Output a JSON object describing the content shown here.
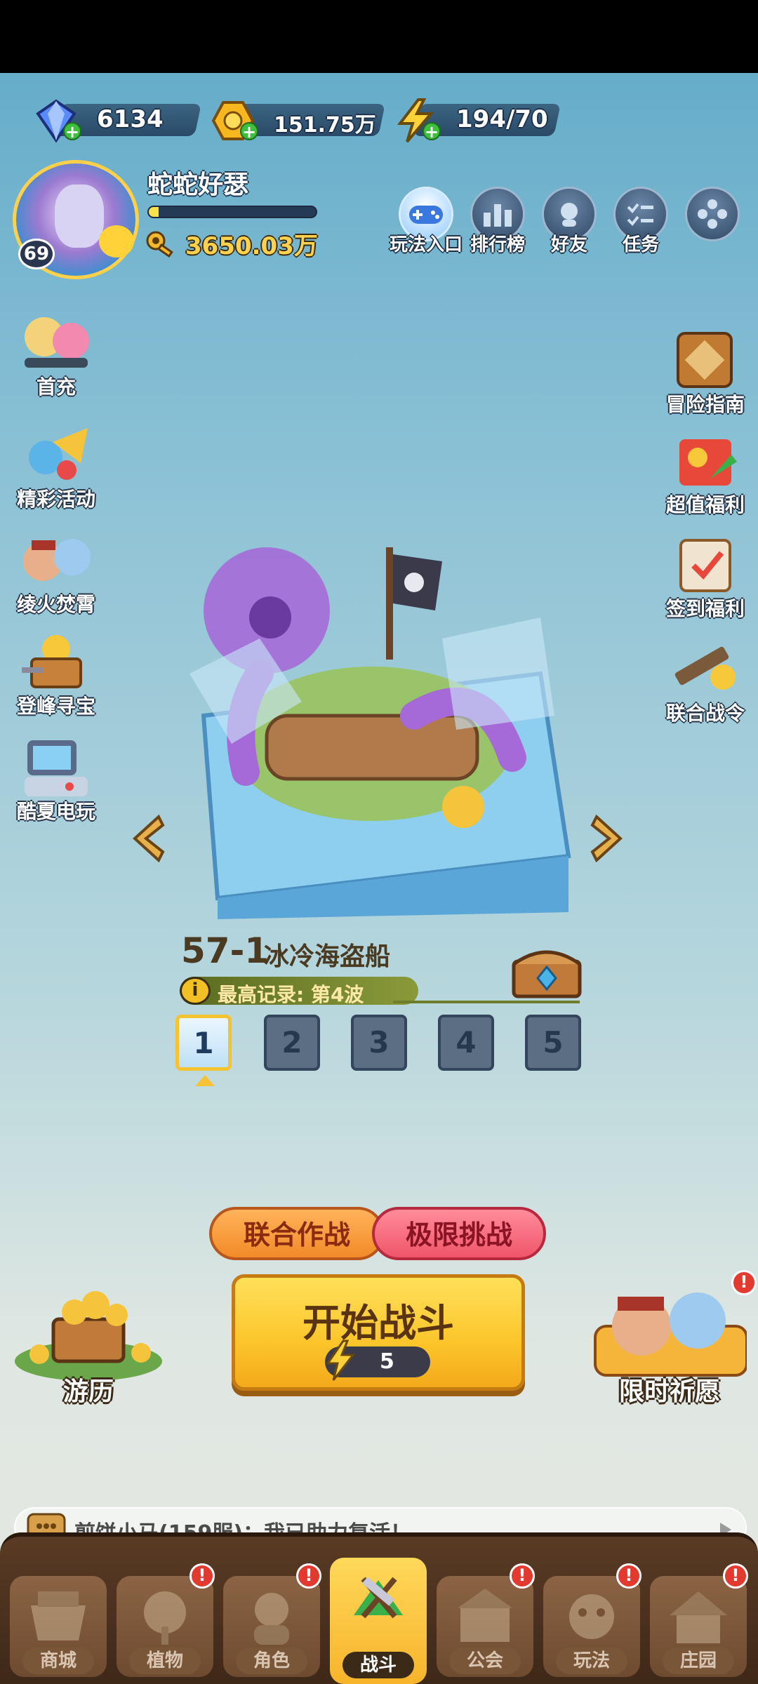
{
  "resources": {
    "gems": "6134",
    "gold": "151.75万",
    "energy": "194/70"
  },
  "profile": {
    "level": "69",
    "name": "蛇蛇好瑟",
    "xp_fraction": 0.06,
    "combat_power": "3650.03万"
  },
  "top_icons": [
    {
      "label": "玩法入口",
      "icon": "gamepad-icon"
    },
    {
      "label": "排行榜",
      "icon": "ranking-icon"
    },
    {
      "label": "好友",
      "icon": "friends-icon"
    },
    {
      "label": "任务",
      "icon": "task-icon"
    },
    {
      "label": "",
      "icon": "more-icon"
    }
  ],
  "left_menu": [
    {
      "label": "首充",
      "icon": "first-recharge-icon"
    },
    {
      "label": "精彩活动",
      "icon": "events-icon"
    },
    {
      "label": "绫火焚霄",
      "icon": "character-event-icon"
    },
    {
      "label": "登峰寻宝",
      "icon": "treasure-hunt-icon"
    },
    {
      "label": "酷夏电玩",
      "icon": "arcade-icon"
    }
  ],
  "right_menu": [
    {
      "label": "冒险指南",
      "icon": "adventure-guide-icon"
    },
    {
      "label": "超值福利",
      "icon": "value-welfare-icon"
    },
    {
      "label": "签到福利",
      "icon": "checkin-icon"
    },
    {
      "label": "联合战令",
      "icon": "battle-pass-icon"
    }
  ],
  "stage": {
    "number": "57-1",
    "name": "冰冷海盗船",
    "record_info_icon": "i",
    "record": "最高记录: 第4波",
    "waves": [
      "1",
      "2",
      "3",
      "4",
      "5"
    ],
    "selected_wave": "1"
  },
  "modes": {
    "coop": "联合作战",
    "limit": "极限挑战"
  },
  "start": {
    "label": "开始战斗",
    "cost": "5"
  },
  "travel": {
    "label": "游历"
  },
  "wish": {
    "label": "限时祈愿",
    "badge": "!"
  },
  "chat": {
    "message": "煎饼小马(159服)：我已助力复活！"
  },
  "nav": [
    {
      "label": "商城",
      "icon": "shop-icon",
      "badge": ""
    },
    {
      "label": "植物",
      "icon": "plants-icon",
      "badge": "!"
    },
    {
      "label": "角色",
      "icon": "character-icon",
      "badge": "!"
    },
    {
      "label": "战斗",
      "icon": "battle-icon",
      "badge": ""
    },
    {
      "label": "公会",
      "icon": "guild-icon",
      "badge": "!"
    },
    {
      "label": "玩法",
      "icon": "gameplay-icon",
      "badge": "!"
    },
    {
      "label": "庄园",
      "icon": "manor-icon",
      "badge": "!"
    }
  ],
  "colors": {
    "accent_yellow": "#fcc52a",
    "coop_orange": "#f28a29",
    "limit_red": "#f0556a",
    "gem_blue": "#5a8cff",
    "energy_yellow": "#ffd23a"
  }
}
